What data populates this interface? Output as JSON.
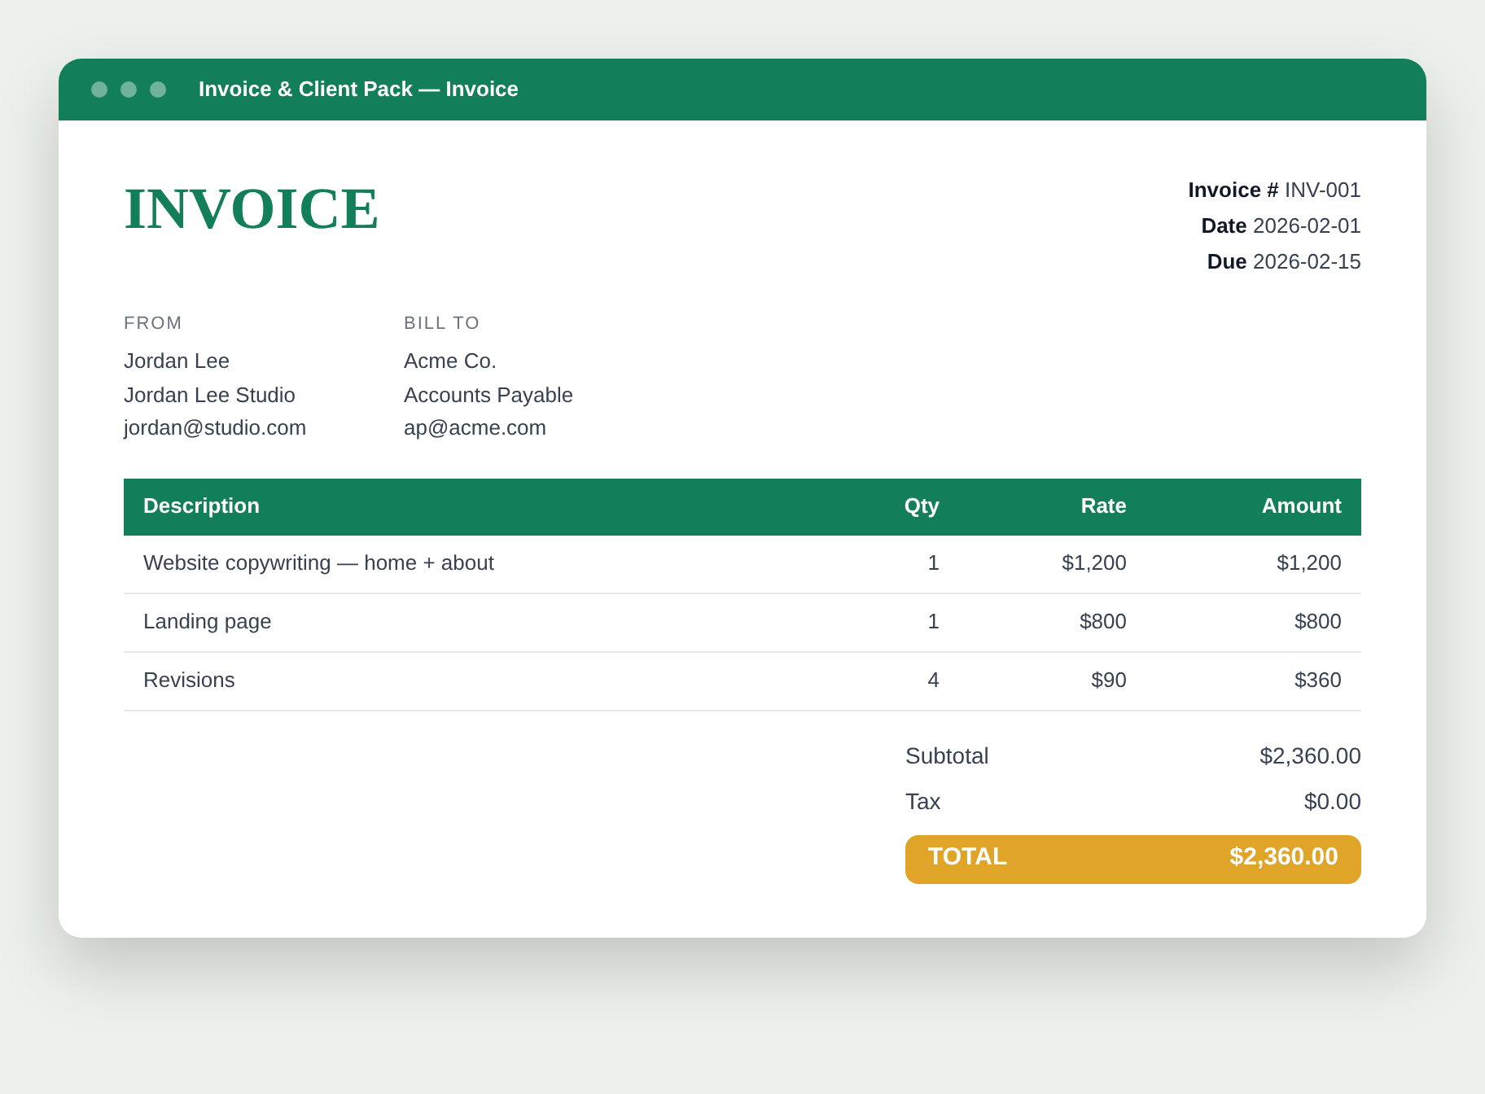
{
  "window": {
    "title": "Invoice & Client Pack — Invoice"
  },
  "invoice": {
    "heading": "INVOICE",
    "meta": [
      {
        "label": "Invoice #",
        "value": "INV-001"
      },
      {
        "label": "Date",
        "value": "2026-02-01"
      },
      {
        "label": "Due",
        "value": "2026-02-15"
      }
    ],
    "parties": [
      {
        "label": "FROM",
        "lines": [
          "Jordan Lee",
          "Jordan Lee Studio",
          "jordan@studio.com"
        ]
      },
      {
        "label": "BILL TO",
        "lines": [
          "Acme Co.",
          "Accounts Payable",
          "ap@acme.com"
        ]
      }
    ],
    "table": {
      "columns": [
        "Description",
        "Qty",
        "Rate",
        "Amount"
      ],
      "rows": [
        [
          "Website copywriting — home + about",
          "1",
          "$1,200",
          "$1,200"
        ],
        [
          "Landing page",
          "1",
          "$800",
          "$800"
        ],
        [
          "Revisions",
          "4",
          "$90",
          "$360"
        ]
      ]
    },
    "totals": [
      {
        "kind": "line",
        "label": "Subtotal",
        "value": "$2,360.00"
      },
      {
        "kind": "line",
        "label": "Tax",
        "value": "$0.00"
      },
      {
        "kind": "grand",
        "label": "TOTAL",
        "value": "$2,360.00"
      }
    ]
  }
}
